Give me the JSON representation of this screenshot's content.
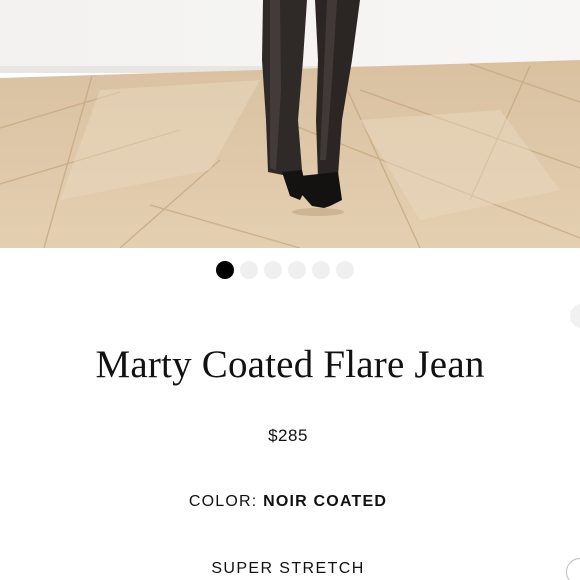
{
  "product": {
    "title": "Marty Coated Flare Jean",
    "price": "$285",
    "color_label": "COLOR:",
    "color_value": "NOIR COATED",
    "fit_label": "SUPER STRETCH"
  },
  "carousel": {
    "total_images": 6,
    "active_index": 0
  },
  "colors": {
    "dot_active": "#000000",
    "dot_inactive": "#efefef",
    "text": "#111111"
  }
}
